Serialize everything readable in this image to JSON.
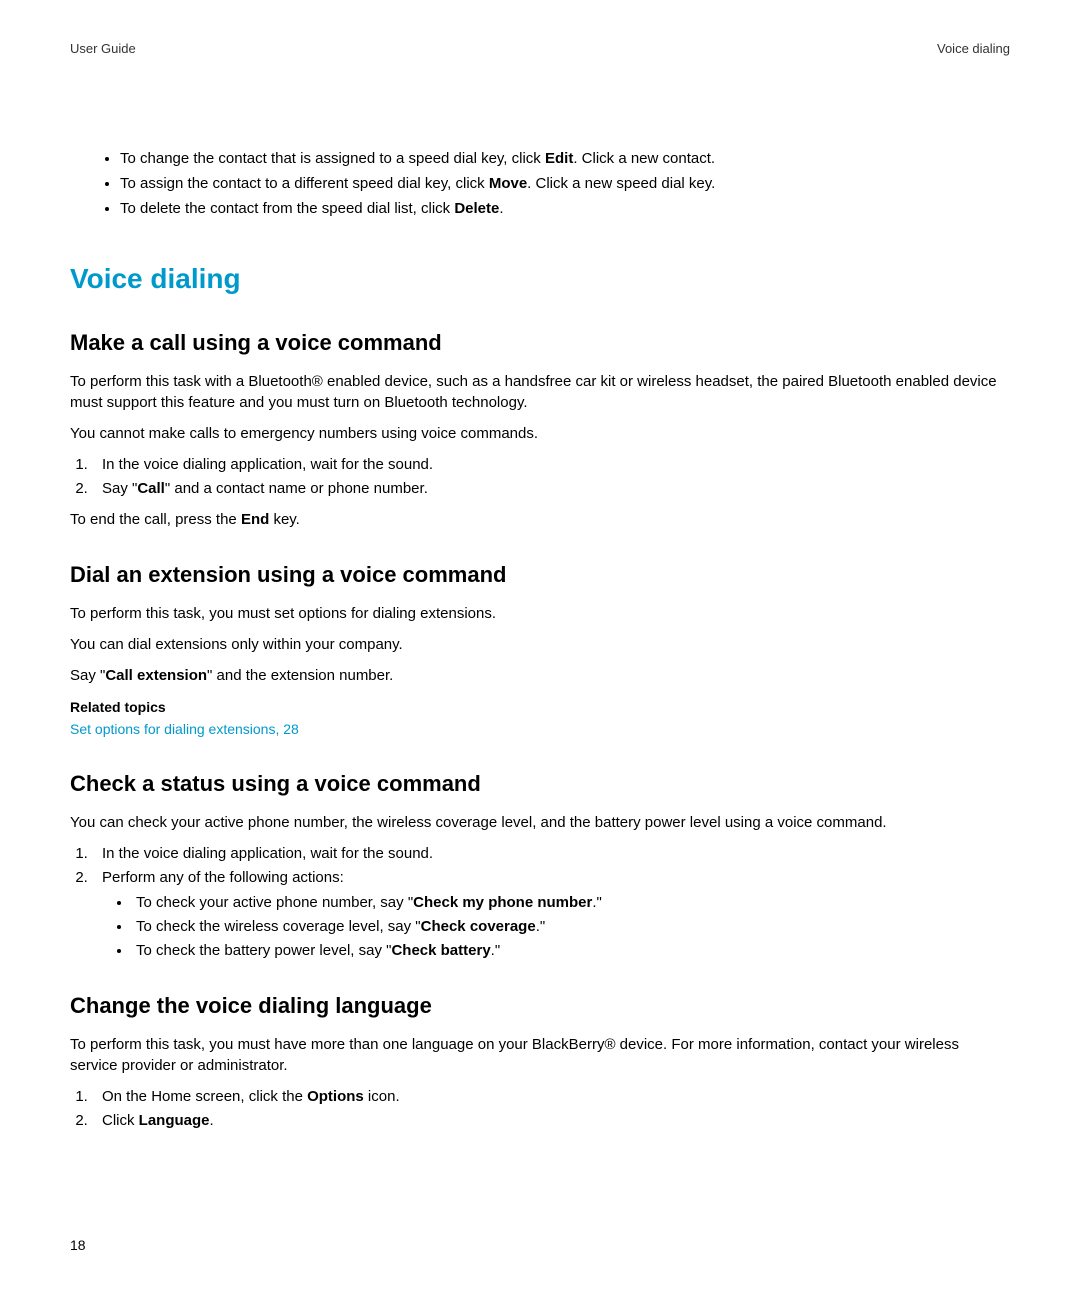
{
  "header": {
    "left": "User Guide",
    "right": "Voice dialing"
  },
  "topBullets": [
    {
      "pre": "To change the contact that is assigned to a speed dial key, click ",
      "bold": "Edit",
      "post": ". Click a new contact."
    },
    {
      "pre": "To assign the contact to a different speed dial key, click ",
      "bold": "Move",
      "post": ". Click a new speed dial key."
    },
    {
      "pre": "To delete the contact from the speed dial list, click ",
      "bold": "Delete",
      "post": "."
    }
  ],
  "h1": "Voice dialing",
  "sec1": {
    "title": "Make a call using a voice command",
    "p1": "To perform this task with a Bluetooth® enabled device, such as a handsfree car kit or wireless headset, the paired Bluetooth enabled device must support this feature and you must turn on Bluetooth technology.",
    "p2": "You cannot make calls to emergency numbers using voice commands.",
    "step1": "In the voice dialing application, wait for the sound.",
    "step2_pre": "Say \"",
    "step2_bold": "Call",
    "step2_post": "\" and a contact name or phone number.",
    "p3_pre": "To end the call, press the ",
    "p3_bold": "End",
    "p3_post": " key."
  },
  "sec2": {
    "title": "Dial an extension using a voice command",
    "p1": "To perform this task, you must set options for dialing extensions.",
    "p2": "You can dial extensions only within your company.",
    "p3_pre": "Say \"",
    "p3_bold": "Call extension",
    "p3_post": "\" and the extension number.",
    "related": "Related topics",
    "link": "Set options for dialing extensions, 28"
  },
  "sec3": {
    "title": "Check a status using a voice command",
    "p1": "You can check your active phone number, the wireless coverage level, and the battery power level using a voice command.",
    "step1": "In the voice dialing application, wait for the sound.",
    "step2": "Perform any of the following actions:",
    "b1_pre": "To check your active phone number, say \"",
    "b1_bold": "Check my phone number",
    "b1_post": ".\"",
    "b2_pre": "To check the wireless coverage level, say \"",
    "b2_bold": "Check coverage",
    "b2_post": ".\"",
    "b3_pre": "To check the battery power level, say \"",
    "b3_bold": "Check battery",
    "b3_post": ".\""
  },
  "sec4": {
    "title": "Change the voice dialing language",
    "p1": "To perform this task, you must have more than one language on your BlackBerry® device. For more information, contact your wireless service provider or administrator.",
    "step1_pre": "On the Home screen, click the ",
    "step1_bold": "Options",
    "step1_post": " icon.",
    "step2_pre": "Click ",
    "step2_bold": "Language",
    "step2_post": "."
  },
  "pageNumber": "18"
}
